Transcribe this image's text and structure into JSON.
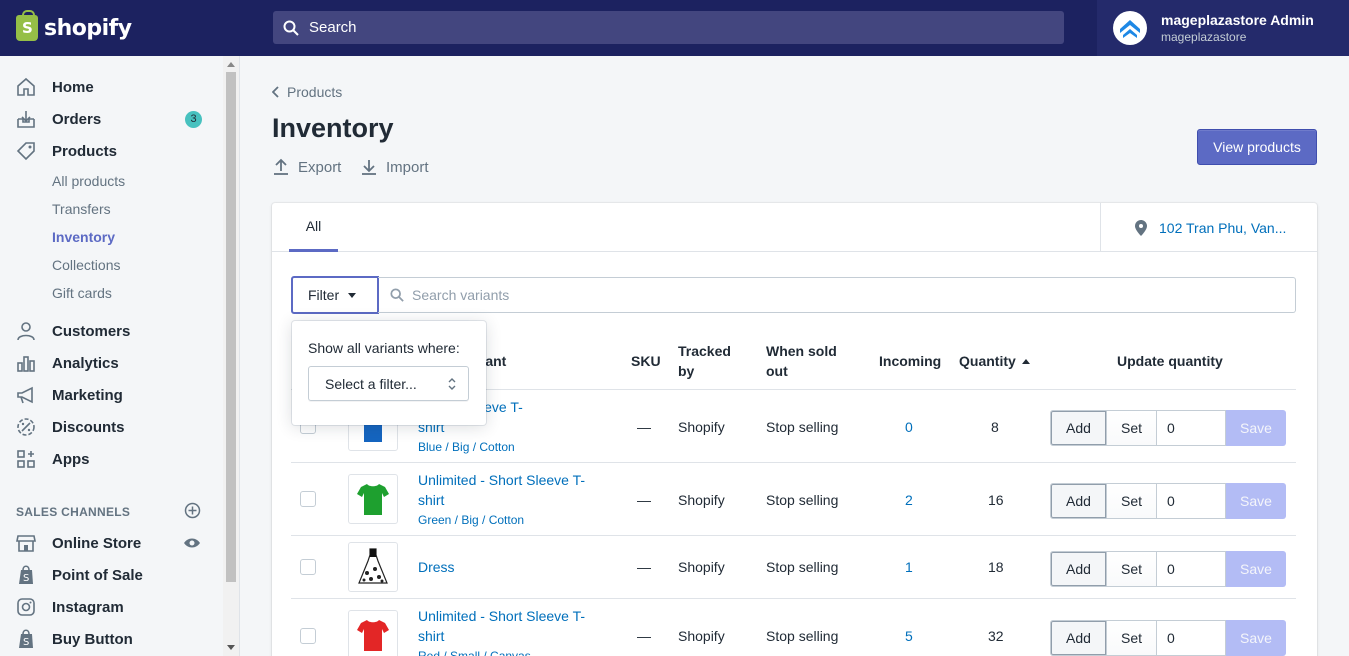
{
  "topbar": {
    "logo_text": "shopify",
    "search_placeholder": "Search",
    "account_name": "mageplazastore Admin",
    "account_store": "mageplazastore"
  },
  "sidebar": {
    "items": [
      {
        "label": "Home",
        "icon": "home-icon"
      },
      {
        "label": "Orders",
        "icon": "orders-icon",
        "badge": "3"
      },
      {
        "label": "Products",
        "icon": "tag-icon"
      }
    ],
    "product_subitems": [
      "All products",
      "Transfers",
      "Inventory",
      "Collections",
      "Gift cards"
    ],
    "more_items": [
      {
        "label": "Customers",
        "icon": "customers-icon"
      },
      {
        "label": "Analytics",
        "icon": "analytics-icon"
      },
      {
        "label": "Marketing",
        "icon": "marketing-icon"
      },
      {
        "label": "Discounts",
        "icon": "discounts-icon"
      },
      {
        "label": "Apps",
        "icon": "apps-icon"
      }
    ],
    "sales_channels_heading": "SALES CHANNELS",
    "channels": [
      {
        "label": "Online Store",
        "icon": "store-icon"
      },
      {
        "label": "Point of Sale",
        "icon": "pos-icon"
      },
      {
        "label": "Instagram",
        "icon": "instagram-icon"
      },
      {
        "label": "Buy Button",
        "icon": "buy-button-icon"
      }
    ]
  },
  "page": {
    "breadcrumb": "Products",
    "title": "Inventory",
    "export_label": "Export",
    "import_label": "Import",
    "view_products_label": "View products"
  },
  "card": {
    "tab_all": "All",
    "location": "102 Tran Phu, Van...",
    "filter_label": "Filter",
    "search_placeholder": "Search variants",
    "headers": {
      "variant": "Variant",
      "variant_visible": "riant",
      "sku": "SKU",
      "tracked_by_1": "Tracked",
      "tracked_by_2": "by",
      "when_sold_out_1": "When sold",
      "when_sold_out_2": "out",
      "incoming": "Incoming",
      "quantity": "Quantity",
      "update_quantity": "Update quantity"
    },
    "rows": [
      {
        "name_line1": "- Short Sleeve T-",
        "name_line2": "shirt",
        "variant": "Blue / Big / Cotton",
        "sku": "—",
        "tracked_by": "Shopify",
        "when_sold_out": "Stop selling",
        "incoming": "0",
        "quantity": "8",
        "add": "Add",
        "set": "Set",
        "input": "0",
        "save": "Save",
        "shirt_color": "#1565c0"
      },
      {
        "name_line1": "Unlimited - Short Sleeve T-",
        "name_line2": "shirt",
        "variant": "Green / Big / Cotton",
        "sku": "—",
        "tracked_by": "Shopify",
        "when_sold_out": "Stop selling",
        "incoming": "2",
        "quantity": "16",
        "add": "Add",
        "set": "Set",
        "input": "0",
        "save": "Save",
        "shirt_color": "#1ea02f"
      },
      {
        "name_line1": "Dress",
        "name_line2": "",
        "variant": "",
        "sku": "—",
        "tracked_by": "Shopify",
        "when_sold_out": "Stop selling",
        "incoming": "1",
        "quantity": "18",
        "add": "Add",
        "set": "Set",
        "input": "0",
        "save": "Save"
      },
      {
        "name_line1": "Unlimited - Short Sleeve T-",
        "name_line2": "shirt",
        "variant": "Red / Small / Canvas",
        "sku": "—",
        "tracked_by": "Shopify",
        "when_sold_out": "Stop selling",
        "incoming": "5",
        "quantity": "32",
        "add": "Add",
        "set": "Set",
        "input": "0",
        "save": "Save",
        "shirt_color": "#e32626"
      }
    ]
  },
  "popover": {
    "title": "Show all variants where:",
    "select_placeholder": "Select a filter..."
  },
  "colors": {
    "topbar": "#1c2260",
    "accent": "#5c6ac4",
    "link": "#006fbb",
    "badge": "#47c1bf"
  }
}
